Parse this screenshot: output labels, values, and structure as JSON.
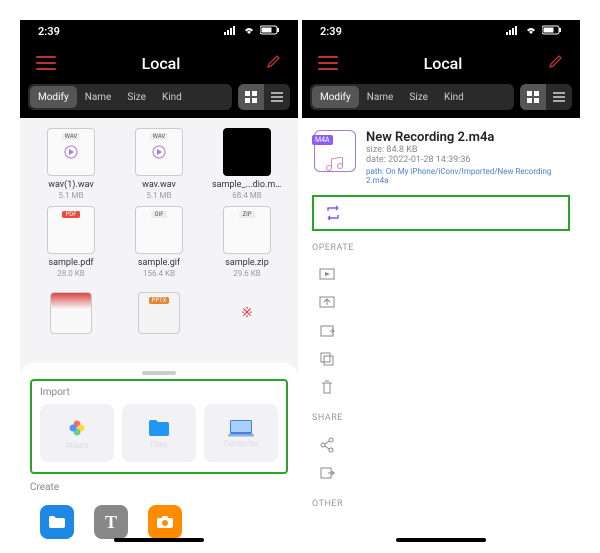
{
  "status": {
    "time": "2:39"
  },
  "header": {
    "title": "Local"
  },
  "filters": {
    "modify": "Modify",
    "name": "Name",
    "size": "Size",
    "kind": "Kind"
  },
  "left": {
    "files": [
      {
        "name": "wav(1).wav",
        "size": "5.1 MB",
        "badge": "WAV"
      },
      {
        "name": "wav.wav",
        "size": "5.1 MB",
        "badge": "WAV"
      },
      {
        "name": "sample_...dio.mov",
        "size": "68.4 MB",
        "badge": ""
      },
      {
        "name": "sample.pdf",
        "size": "28.0 KB",
        "badge": "PDF"
      },
      {
        "name": "sample.gif",
        "size": "156.4 KB",
        "badge": "GIF"
      },
      {
        "name": "sample.zip",
        "size": "29.6 KB",
        "badge": "ZIP"
      }
    ],
    "sheet": {
      "import_label": "Import",
      "create_label": "Create",
      "sources": {
        "album": "Album",
        "files": "Files",
        "computer": "Computer"
      }
    }
  },
  "right": {
    "file": {
      "ext": "M4A",
      "name": "New Recording 2.m4a",
      "size_label": "size: 84.8 KB",
      "date_label": "date: 2022-01-28 14:39:36",
      "path_label": "path: On My iPhone/iConv/Imported/New Recording 2.m4a"
    },
    "sections": {
      "operate": "OPERATE",
      "share": "SHARE",
      "other": "OTHER"
    }
  }
}
